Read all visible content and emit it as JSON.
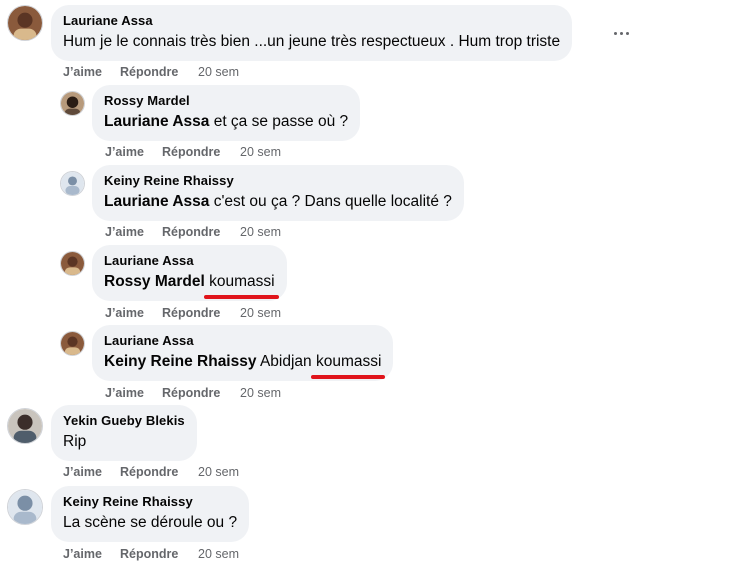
{
  "comments": [
    {
      "author": "Lauriane Assa",
      "text": "Hum je le connais très bien ...un jeune très respectueux . Hum trop triste",
      "like": "J’aime",
      "reply": "Répondre",
      "time": "20 sem"
    },
    {
      "author": "Rossy Mardel",
      "mention": "Lauriane Assa",
      "text": "et ça se passe où ?",
      "like": "J’aime",
      "reply": "Répondre",
      "time": "20 sem"
    },
    {
      "author": "Keiny Reine Rhaissy",
      "mention": "Lauriane Assa",
      "text": "c'est ou ça ? Dans quelle localité ?",
      "like": "J’aime",
      "reply": "Répondre",
      "time": "20 sem"
    },
    {
      "author": "Lauriane Assa",
      "mention": "Rossy Mardel",
      "text": "koumassi",
      "like": "J’aime",
      "reply": "Répondre",
      "time": "20 sem"
    },
    {
      "author": "Lauriane Assa",
      "mention": "Keiny Reine Rhaissy",
      "text_prefix": "Abidjan",
      "text": "koumassi",
      "like": "J’aime",
      "reply": "Répondre",
      "time": "20 sem"
    },
    {
      "author": "Yekin Gueby Blekis",
      "text": "Rip",
      "like": "J’aime",
      "reply": "Répondre",
      "time": "20 sem"
    },
    {
      "author": "Keiny Reine Rhaissy",
      "text": "La scène se déroule ou ?",
      "like": "J’aime",
      "reply": "Répondre",
      "time": "20 sem"
    }
  ],
  "icons": {
    "more": "more-options-icon",
    "avatar": "profile-avatar"
  },
  "colors": {
    "bubble": "#f0f2f5",
    "meta": "#65676b",
    "highlight_underline": "#e0141b"
  }
}
